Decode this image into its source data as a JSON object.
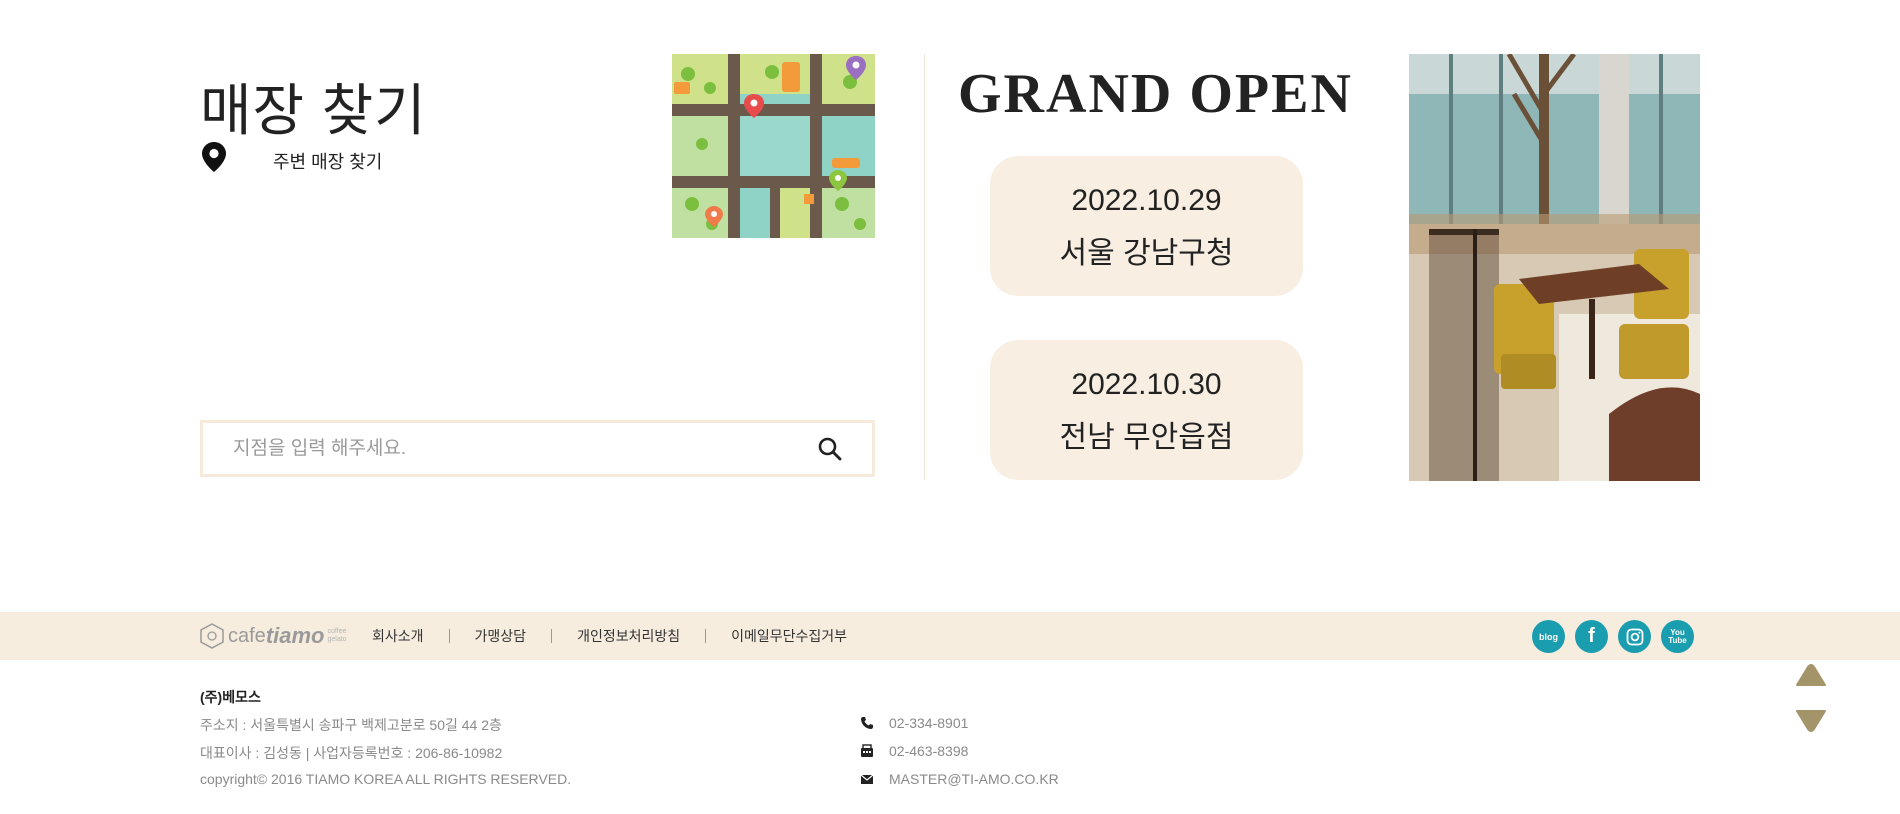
{
  "store_finder": {
    "title": "매장 찾기",
    "nearby_label": "주변 매장 찾기",
    "search_placeholder": "지점을 입력 해주세요."
  },
  "grand_open": {
    "title": "GRAND OPEN",
    "events": [
      {
        "date": "2022.10.29",
        "place": "서울 강남구청"
      },
      {
        "date": "2022.10.30",
        "place": "전남 무안읍점"
      }
    ]
  },
  "footer": {
    "logo": {
      "cafe": "cafe",
      "brand": "tiamo",
      "tagline": "coffee gelato"
    },
    "nav": [
      "회사소개",
      "가맹상담",
      "개인정보처리방침",
      "이메일무단수집거부"
    ],
    "socials": [
      "blog",
      "f",
      "ig",
      "You Tube"
    ],
    "company": "(주)베모스",
    "address": "주소지 : 서울특별시 송파구 백제고분로 50길 44 2층",
    "ceo": "대표이사 : 김성동 | 사업자등록번호 : 206-86-10982",
    "copyright": "copyright© 2016 TIAMO KOREA ALL RIGHTS RESERVED.",
    "phone": "02-334-8901",
    "fax": "02-463-8398",
    "email": "MASTER@TI-AMO.CO.KR"
  },
  "colors": {
    "accent_beige": "#f8efe2",
    "footer_bar": "#f6eddf",
    "social_teal": "#1b9db0",
    "scroll_arrow": "#a4946a"
  },
  "icons": [
    "map-pin-icon",
    "search-icon",
    "phone-icon",
    "fax-icon",
    "mail-icon",
    "scroll-up-icon",
    "scroll-down-icon"
  ]
}
